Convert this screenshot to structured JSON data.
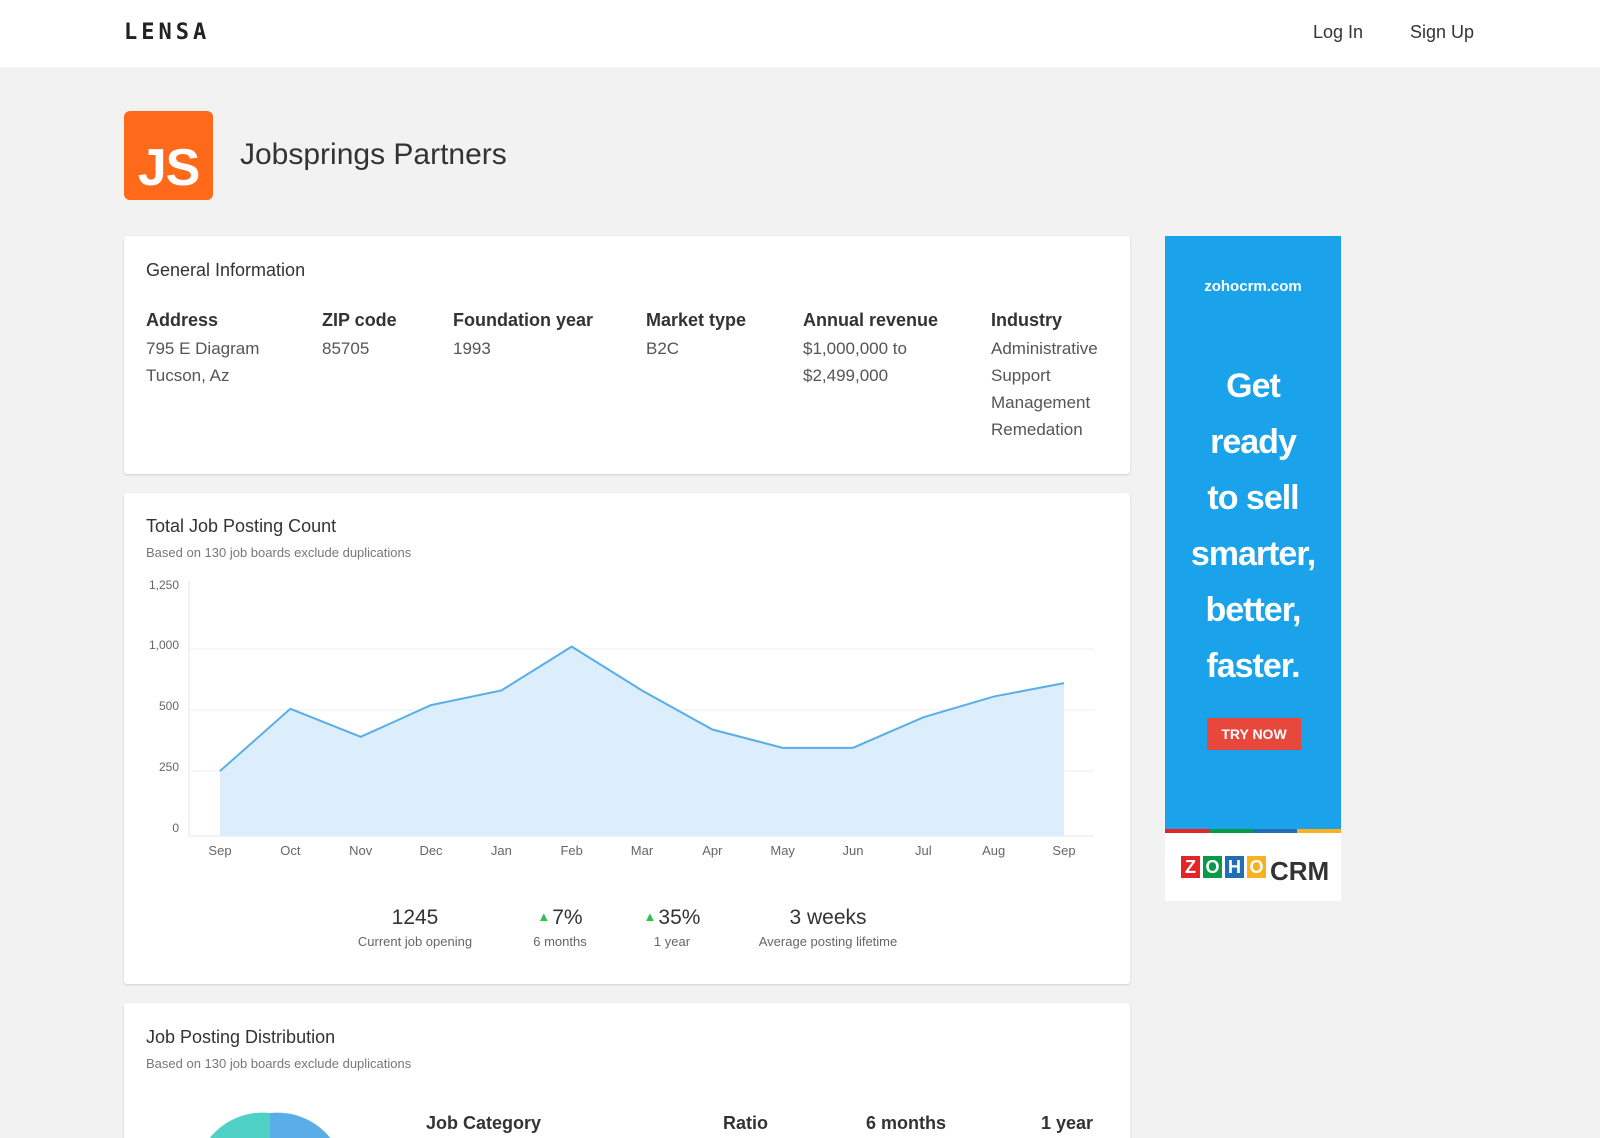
{
  "topbar": {
    "logo": "LENSA",
    "login": "Log In",
    "signup": "Sign Up"
  },
  "company": {
    "logo_text": "JS",
    "name": "Jobsprings Partners"
  },
  "general_info": {
    "title": "General Information",
    "columns": [
      {
        "label": "Address",
        "lines": [
          "795 E Diagram",
          "Tucson, Az"
        ]
      },
      {
        "label": "ZIP code",
        "lines": [
          "85705"
        ]
      },
      {
        "label": "Foundation year",
        "lines": [
          "1993"
        ]
      },
      {
        "label": "Market type",
        "lines": [
          "B2C"
        ]
      },
      {
        "label": "Annual revenue",
        "lines": [
          "$1,000,000 to",
          "$2,499,000"
        ]
      },
      {
        "label": "Industry",
        "lines": [
          "Administrative",
          "Support",
          "Management",
          "Remedation"
        ]
      }
    ]
  },
  "job_count": {
    "title": "Total Job Posting Count",
    "subtitle": "Based on 130 job boards exclude duplications",
    "stats": [
      {
        "value": "1245",
        "label": "Current job opening",
        "up": false
      },
      {
        "value": "7%",
        "label": "6 months",
        "up": true
      },
      {
        "value": "35%",
        "label": "1 year",
        "up": true
      },
      {
        "value": "3 weeks",
        "label": "Average posting lifetime",
        "up": false
      }
    ]
  },
  "chart_data": {
    "type": "area",
    "x": [
      "Sep",
      "Oct",
      "Nov",
      "Dec",
      "Jan",
      "Feb",
      "Mar",
      "Apr",
      "May",
      "Jun",
      "Jul",
      "Aug",
      "Sep"
    ],
    "y_ticks": [
      "0",
      "250",
      "500",
      "1,000",
      "1,250"
    ],
    "series": [
      {
        "values": [
          250,
          510,
          390,
          540,
          660,
          1010,
          660,
          420,
          345,
          345,
          470,
          610,
          720
        ]
      }
    ],
    "grid": true,
    "color": "#5aaee8",
    "fill": "#dcedfb"
  },
  "distribution": {
    "title": "Job Posting Distribution",
    "subtitle": "Based on 130 job boards exclude duplications",
    "headers": {
      "category": "Job Category",
      "ratio": "Ratio",
      "six": "6 months",
      "year": "1 year"
    }
  },
  "ad": {
    "domain": "zohocrm.com",
    "headline": [
      "Get",
      "ready",
      "to sell",
      "smarter,",
      "better,",
      "faster."
    ],
    "cta": "TRY NOW",
    "brand_letters": [
      "Z",
      "O",
      "H",
      "O"
    ],
    "brand_colors": [
      "#e42527",
      "#089949",
      "#226db4",
      "#f9b21d"
    ],
    "brand_suffix": "CRM"
  }
}
